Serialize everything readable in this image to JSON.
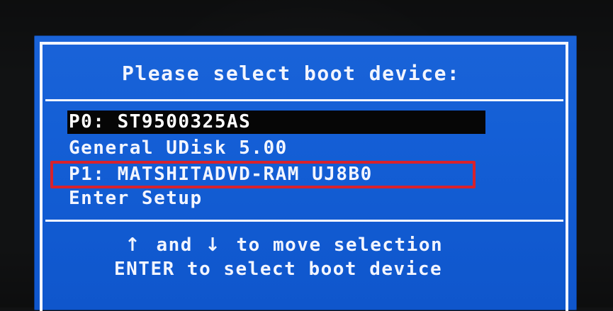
{
  "boot_menu": {
    "title": "Please select boot device:",
    "items": [
      {
        "label": "P0: ST9500325AS",
        "selected": true
      },
      {
        "label": "General UDisk 5.00",
        "selected": false
      },
      {
        "label": "P1: MATSHITADVD-RAM UJ8B0",
        "selected": false
      },
      {
        "label": "Enter Setup",
        "selected": false
      }
    ],
    "help": {
      "up_icon": "up-arrow-icon",
      "down_icon": "down-arrow-icon",
      "up_glyph": "↑",
      "down_glyph": "↓",
      "and_text": "and",
      "move_text": "to move selection",
      "enter_line": "ENTER to select boot device"
    }
  },
  "colors": {
    "screen_blue": "#145fd6",
    "frame_white": "#f2f5ff",
    "selection_black": "#060606",
    "highlight_red": "#d8222c"
  }
}
